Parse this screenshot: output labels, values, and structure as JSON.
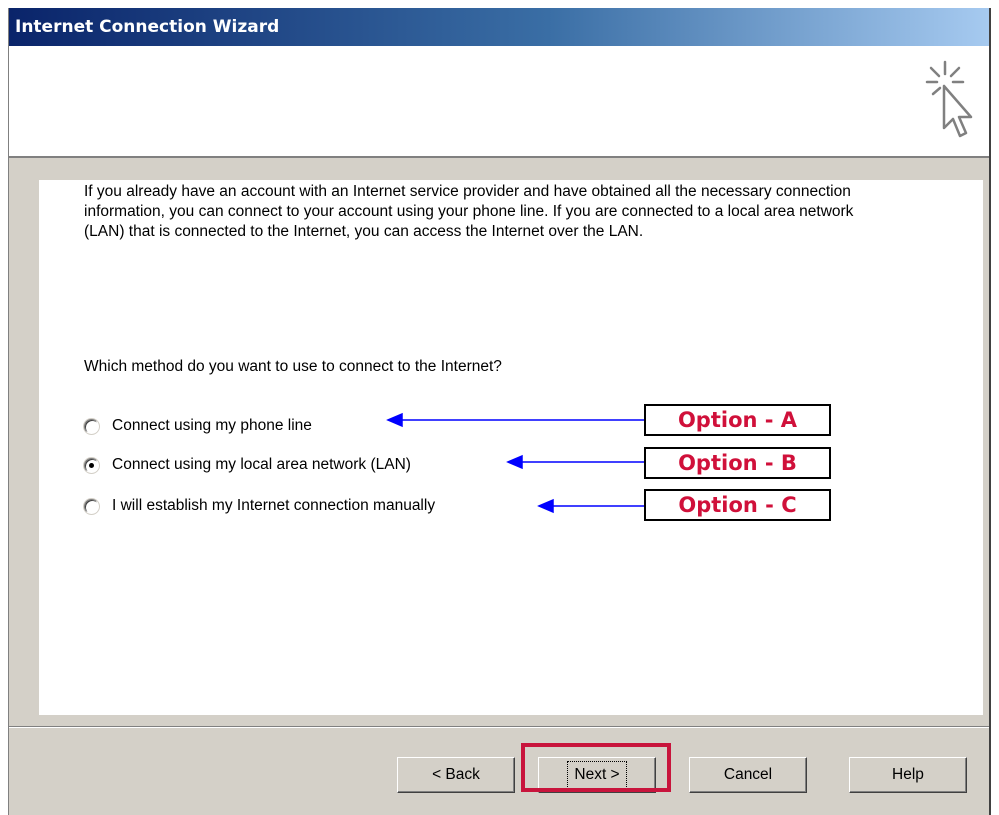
{
  "window": {
    "title": "Internet Connection Wizard"
  },
  "intro_text": "If you already have an account with an Internet service provider and have obtained all the necessary connection information, you can connect to your account using your phone line. If you are connected to a local area network (LAN) that is connected to the Internet, you can access the Internet over the LAN.",
  "question": "Which method do you want to use to connect to the Internet?",
  "options": [
    {
      "label": "Connect using my phone line",
      "checked": false
    },
    {
      "label": "Connect using my local area network (LAN)",
      "checked": true
    },
    {
      "label": "I will establish my Internet connection manually",
      "checked": false
    }
  ],
  "buttons": {
    "back": "< Back",
    "next": "Next >",
    "cancel": "Cancel",
    "help": "Help"
  },
  "annotations": [
    "Option - A",
    "Option - B",
    "Option - C"
  ],
  "colors": {
    "annotation_text": "#d0103a",
    "highlight_border": "#c8143c",
    "arrow": "#0000ff"
  },
  "icons": {
    "header": "wizard-cursor-icon"
  }
}
